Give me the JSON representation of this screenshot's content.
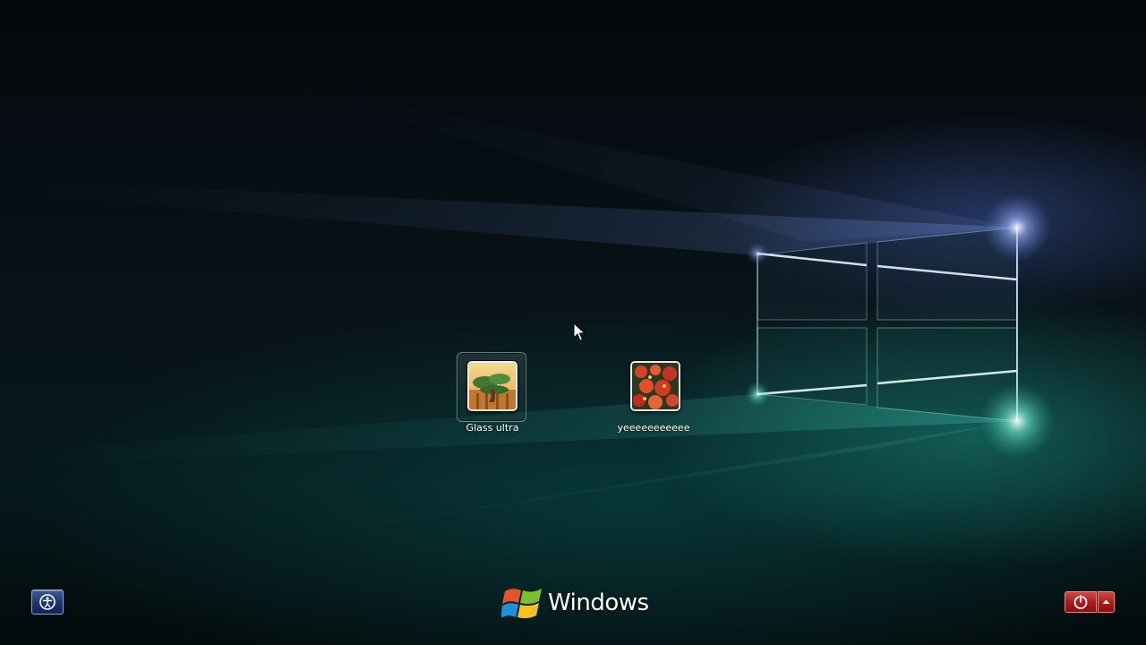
{
  "users": [
    {
      "name": "Glass ultra",
      "selected": true,
      "avatar": "bonsai-picture"
    },
    {
      "name": "yeeeeeeeeeee",
      "selected": false,
      "avatar": "red-flowers-picture"
    }
  ],
  "branding": {
    "logo": "windows-flag-icon",
    "text": "Windows"
  },
  "controls": {
    "ease_of_access": "ease-of-access-icon",
    "power": "power-icon",
    "power_options": "triangle-up-icon"
  },
  "colors": {
    "power_red": "#a81a1a",
    "ease_blue": "#1b3470",
    "wallpaper_teal": "#28c8b4"
  }
}
